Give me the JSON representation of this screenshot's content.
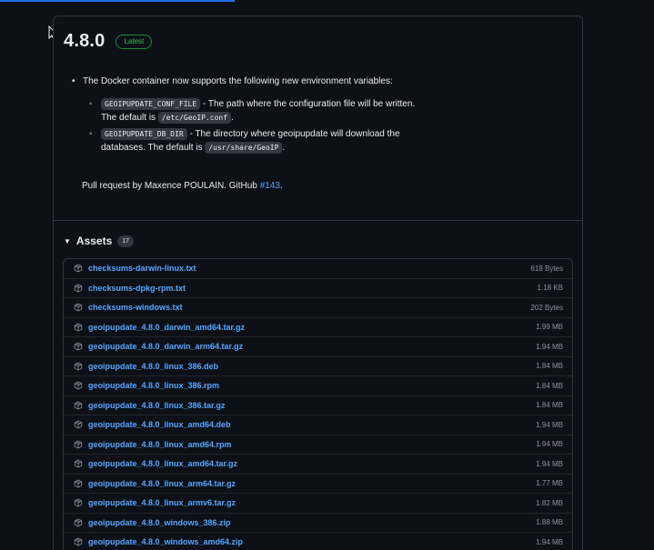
{
  "release": {
    "version": "4.8.0",
    "badge": "Latest"
  },
  "notes": {
    "intro": "The Docker container now supports the following new environment variables:",
    "items": [
      {
        "code": "GEOIPUPDATE_CONF_FILE",
        "text_before": " - The path where the configuration file will be written. The default is ",
        "default_code": "/etc/GeoIP.conf",
        "text_after": "."
      },
      {
        "code": "GEOIPUPDATE_DB_DIR",
        "text_before": " - The directory where geoipupdate will download the databases. The default is ",
        "default_code": "/usr/share/GeoIP",
        "text_after": "."
      }
    ],
    "pr_prefix": "Pull request by Maxence POULAIN. GitHub ",
    "pr_link": "#143",
    "pr_suffix": "."
  },
  "assets": {
    "title": "Assets",
    "count": "17",
    "items": [
      {
        "name": "checksums-darwin-linux.txt",
        "size": "618 Bytes"
      },
      {
        "name": "checksums-dpkg-rpm.txt",
        "size": "1.18 KB"
      },
      {
        "name": "checksums-windows.txt",
        "size": "202 Bytes"
      },
      {
        "name": "geoipupdate_4.8.0_darwin_amd64.tar.gz",
        "size": "1.99 MB"
      },
      {
        "name": "geoipupdate_4.8.0_darwin_arm64.tar.gz",
        "size": "1.94 MB"
      },
      {
        "name": "geoipupdate_4.8.0_linux_386.deb",
        "size": "1.84 MB"
      },
      {
        "name": "geoipupdate_4.8.0_linux_386.rpm",
        "size": "1.84 MB"
      },
      {
        "name": "geoipupdate_4.8.0_linux_386.tar.gz",
        "size": "1.84 MB"
      },
      {
        "name": "geoipupdate_4.8.0_linux_amd64.deb",
        "size": "1.94 MB"
      },
      {
        "name": "geoipupdate_4.8.0_linux_amd64.rpm",
        "size": "1.94 MB"
      },
      {
        "name": "geoipupdate_4.8.0_linux_amd64.tar.gz",
        "size": "1.94 MB"
      },
      {
        "name": "geoipupdate_4.8.0_linux_arm64.tar.gz",
        "size": "1.77 MB"
      },
      {
        "name": "geoipupdate_4.8.0_linux_armv6.tar.gz",
        "size": "1.82 MB"
      },
      {
        "name": "geoipupdate_4.8.0_windows_386.zip",
        "size": "1.88 MB"
      },
      {
        "name": "geoipupdate_4.8.0_windows_amd64.zip",
        "size": "1.94 MB"
      }
    ]
  },
  "colors": {
    "background": "#0d1117",
    "link": "#58a6ff",
    "badge_green": "#3fb950",
    "border": "#30363d"
  },
  "icons": [
    "mouse-cursor-icon",
    "package-icon",
    "caret-down-icon"
  ]
}
